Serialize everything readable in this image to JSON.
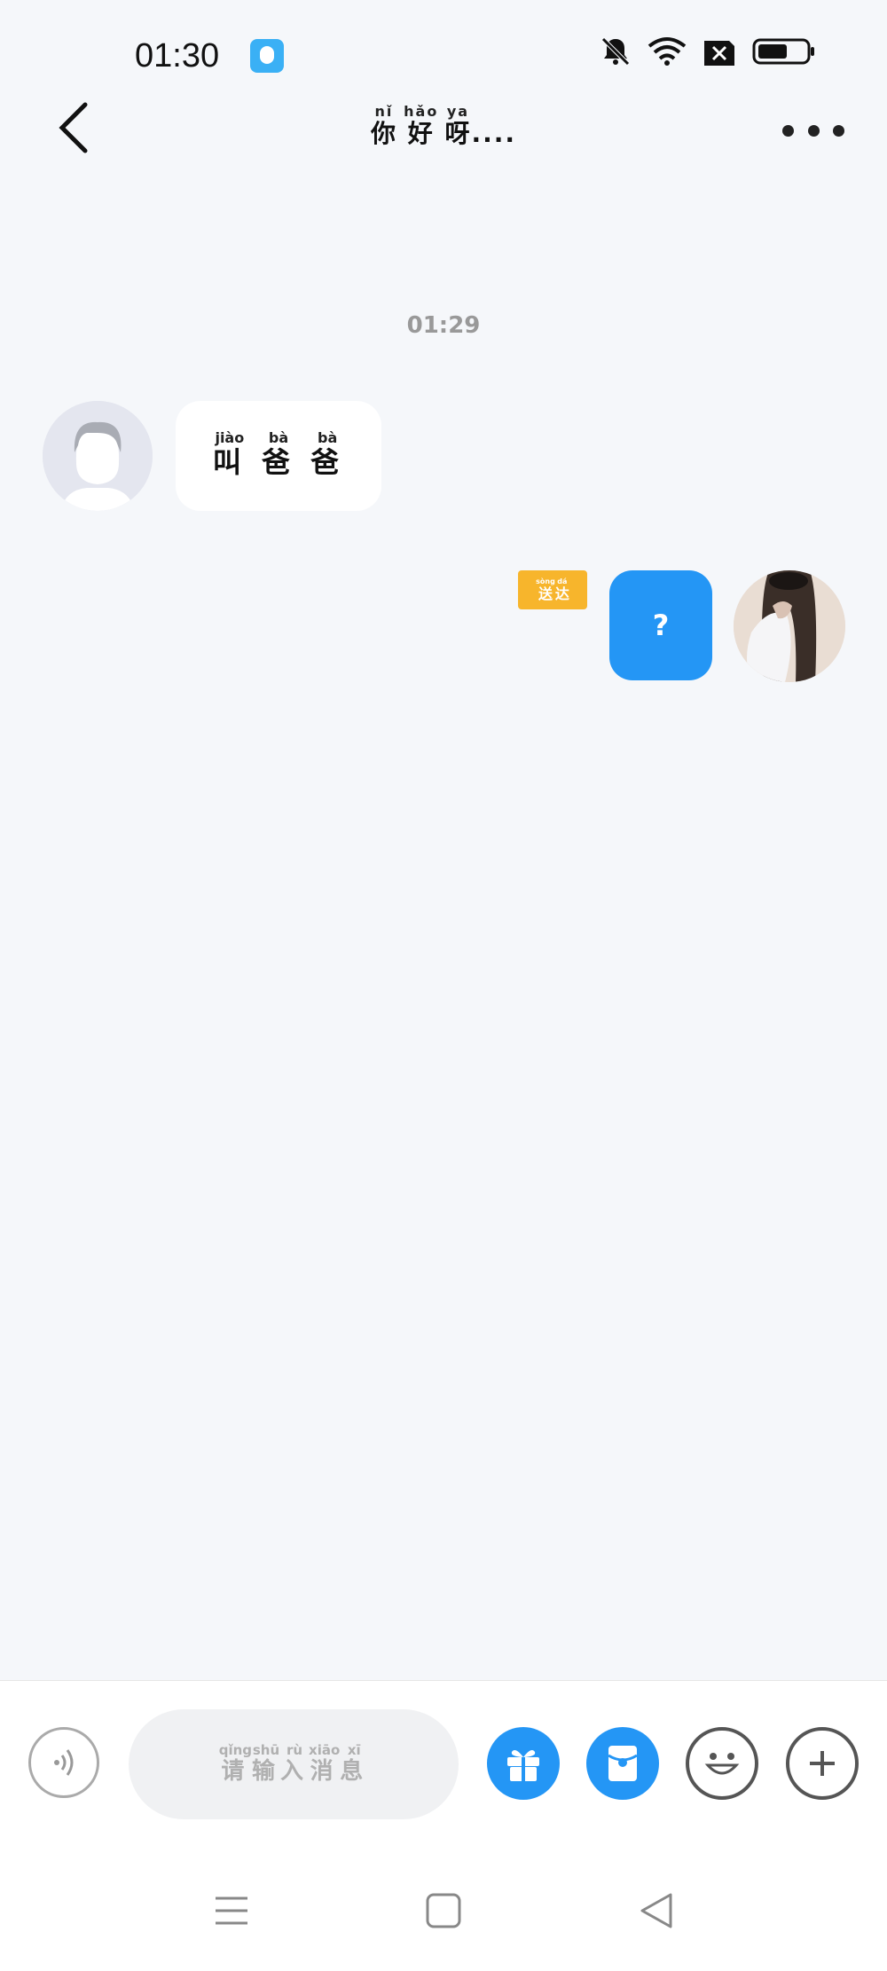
{
  "status_bar": {
    "time": "01:30"
  },
  "header": {
    "title": [
      {
        "char": "你",
        "pinyin": "nǐ"
      },
      {
        "char": "好",
        "pinyin": "hǎo"
      },
      {
        "char": "呀",
        "pinyin": "ya"
      }
    ],
    "title_suffix": "...."
  },
  "chat": {
    "timestamp": "01:29",
    "messages": [
      {
        "direction": "incoming",
        "text": [
          {
            "char": "叫",
            "pinyin": "jiào"
          },
          {
            "char": "爸",
            "pinyin": "bà"
          },
          {
            "char": "爸",
            "pinyin": "bà"
          }
        ]
      },
      {
        "direction": "outgoing",
        "text": "?",
        "status": [
          {
            "char": "送",
            "pinyin": "sòng"
          },
          {
            "char": "达",
            "pinyin": "dá"
          }
        ]
      }
    ]
  },
  "input": {
    "placeholder": [
      {
        "char": "请",
        "pinyin": "qǐng"
      },
      {
        "char": "输",
        "pinyin": "shū"
      },
      {
        "char": "入",
        "pinyin": "rù"
      },
      {
        "char": "消",
        "pinyin": "xiāo"
      },
      {
        "char": "息",
        "pinyin": "xī"
      }
    ]
  },
  "icons": {
    "back": "back-arrow-icon",
    "more": "more-dots-icon",
    "voice": "voice-icon",
    "gift": "gift-icon",
    "red_packet": "red-packet-icon",
    "emoji": "emoji-icon",
    "plus": "plus-icon"
  },
  "colors": {
    "accent": "#2496f5",
    "badge": "#f7b52c",
    "background": "#f5f7fa"
  }
}
